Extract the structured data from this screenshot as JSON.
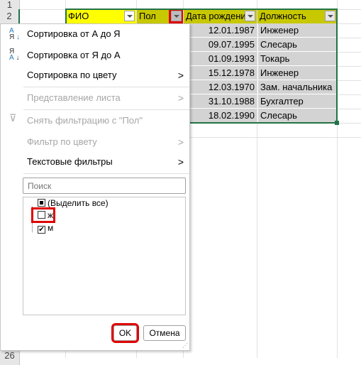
{
  "sheet": {
    "row_numbers": [
      "1",
      "2",
      "26"
    ],
    "headers": [
      "ФИО",
      "Пол",
      "Дата рождения",
      "Должность"
    ],
    "rows": [
      {
        "date": "12.01.1987",
        "position": "Инженер"
      },
      {
        "date": "09.07.1995",
        "position": "Слесарь"
      },
      {
        "date": "01.09.1993",
        "position": "Токарь"
      },
      {
        "date": "15.12.1978",
        "position": "Инженер"
      },
      {
        "date": "12.03.1970",
        "position": "Зам. начальника"
      },
      {
        "date": "31.10.1988",
        "position": "Бухгалтер"
      },
      {
        "date": "18.02.1990",
        "position": "Слесарь"
      }
    ],
    "colors": {
      "header_fill": "#c8c800",
      "fio_header_fill": "#ffff00",
      "selection": "#d3d3d3",
      "highlight": "#e00000"
    }
  },
  "menu": {
    "sort_az": "Сортировка от А до Я",
    "sort_za": "Сортировка от Я до А",
    "sort_color": "Сортировка по цвету",
    "sheet_view": "Представление листа",
    "clear_filter": "Снять фильтрацию с \"Пол\"",
    "color_filter": "Фильтр по цвету",
    "text_filters": "Текстовые фильтры",
    "search_placeholder": "Поиск",
    "items": [
      {
        "label": "(Выделить все)",
        "state": "indeterminate"
      },
      {
        "label": "ж",
        "state": "unchecked"
      },
      {
        "label": "м",
        "state": "checked"
      }
    ],
    "ok": "OK",
    "cancel": "Отмена"
  }
}
